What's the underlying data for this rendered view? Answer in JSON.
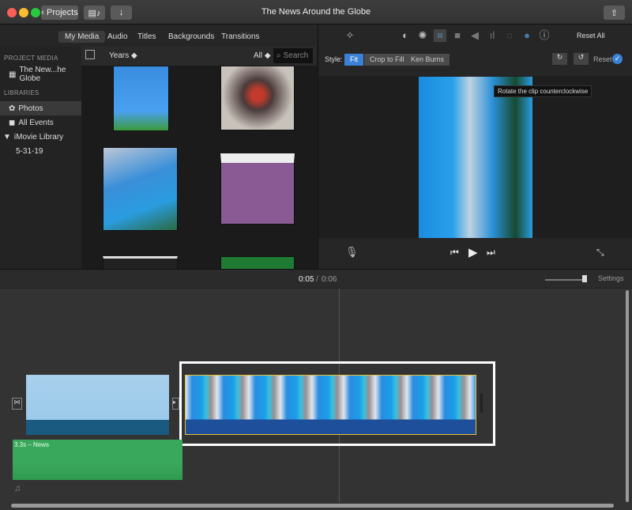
{
  "window": {
    "title": "The News Around the Globe",
    "back_label": "Projects"
  },
  "tabs": [
    "My Media",
    "Audio",
    "Titles",
    "Backgrounds",
    "Transitions"
  ],
  "sidebar": {
    "project_media_heading": "PROJECT MEDIA",
    "project_item": "The New...he Globe",
    "libraries_heading": "LIBRARIES",
    "items": [
      "Photos",
      "All Events",
      "iMovie Library",
      "5-31-19"
    ]
  },
  "browser": {
    "sort_label": "Years ◆",
    "filter_label": "All ◆",
    "search_placeholder": "Search"
  },
  "viewer": {
    "reset_all": "Reset All",
    "style_label": "Style:",
    "styles": [
      "Fit",
      "Crop to Fill",
      "Ken Burns"
    ],
    "reset_label": "Reset",
    "tooltip": "Rotate the clip counterclockwise"
  },
  "timeline": {
    "current_time": "0:05",
    "separator": "/",
    "total_time": "0:06",
    "settings_label": "Settings",
    "audio_clip_label": "3.3s – News"
  },
  "colors": {
    "accent": "#3b82d6",
    "audio_green": "#3aa85c",
    "selection": "#e8c03a"
  }
}
